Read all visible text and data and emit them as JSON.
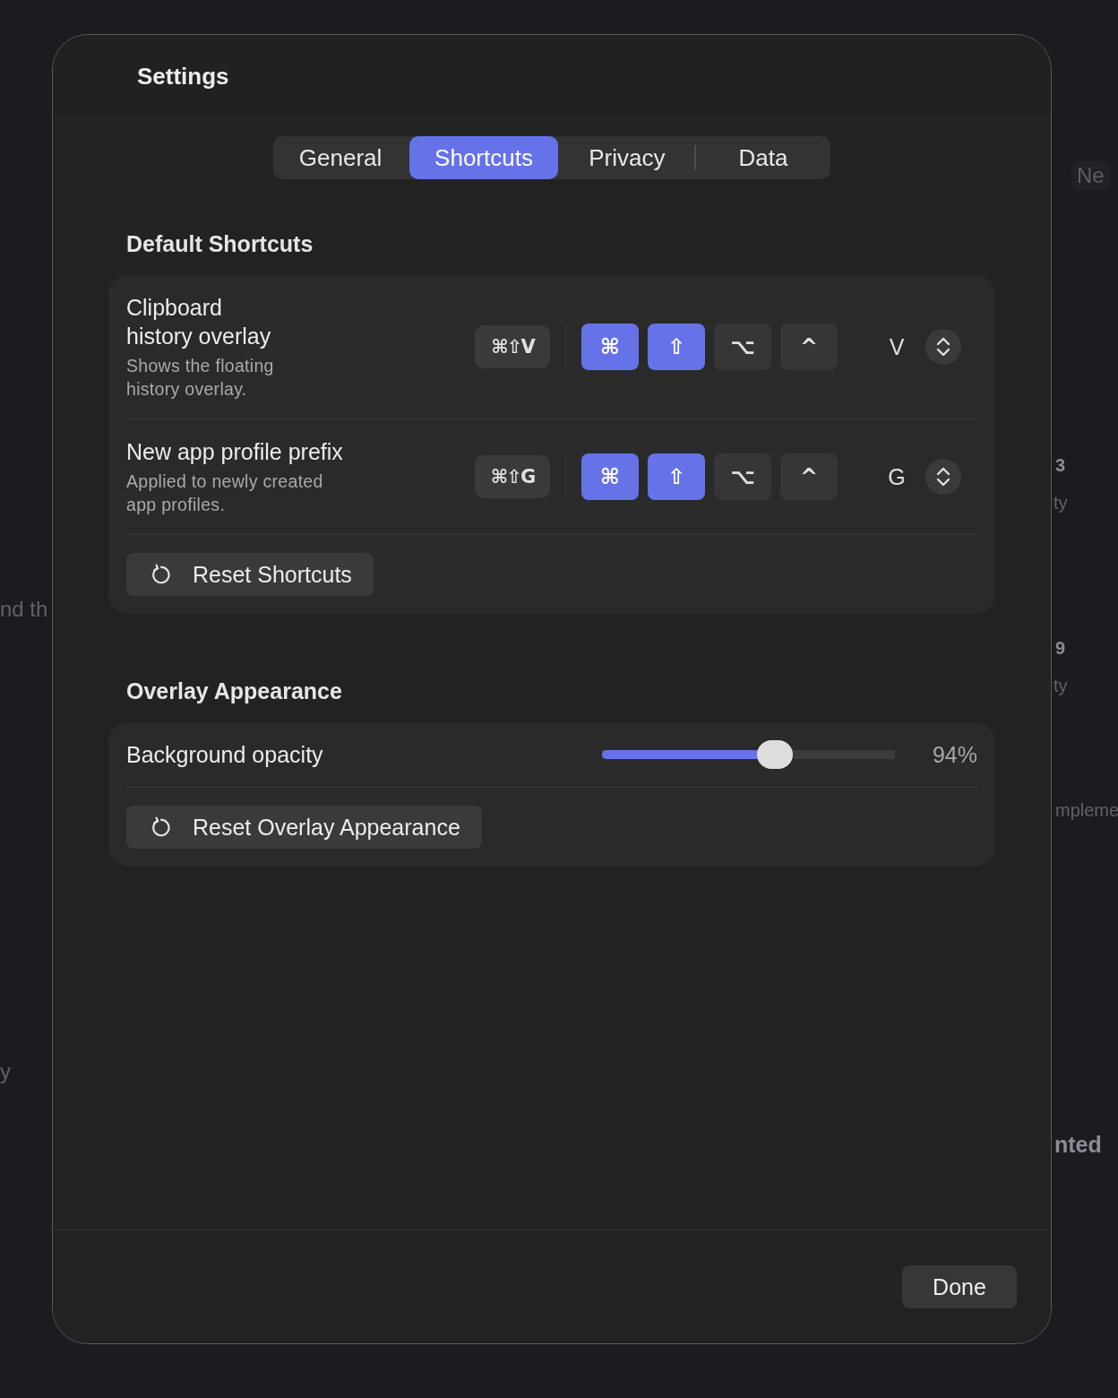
{
  "backdrop": {
    "fragments": [
      {
        "text": "Ne",
        "kind": "button"
      },
      {
        "text": "3",
        "kind": "strong"
      },
      {
        "text": "ty",
        "kind": "muted"
      },
      {
        "text": "9",
        "kind": "strong"
      },
      {
        "text": "ty",
        "kind": "muted"
      },
      {
        "text": "mpleme",
        "kind": "muted"
      },
      {
        "text": "nted",
        "kind": "strong"
      },
      {
        "text": "nd th",
        "kind": "muted"
      },
      {
        "text": "y",
        "kind": "muted"
      }
    ]
  },
  "window": {
    "title": "Settings"
  },
  "tabs": [
    {
      "label": "General",
      "selected": false
    },
    {
      "label": "Shortcuts",
      "selected": true
    },
    {
      "label": "Privacy",
      "selected": false
    },
    {
      "label": "Data",
      "selected": false
    }
  ],
  "sections": [
    {
      "title": "Default Shortcuts",
      "rows": [
        {
          "kind": "shortcut",
          "title": "Clipboard\nhistory overlay",
          "description": "Shows the floating\nhistory overlay.",
          "summary": "⌘⇧V",
          "modifiers": [
            {
              "symbol": "⌘",
              "on": true
            },
            {
              "symbol": "⇧",
              "on": true
            },
            {
              "symbol": "⌥",
              "on": false
            },
            {
              "symbol": "^",
              "on": false
            }
          ],
          "key": "V"
        },
        {
          "kind": "shortcut",
          "title": "New app profile prefix",
          "description": "Applied to newly created\napp profiles.",
          "summary": "⌘⇧G",
          "modifiers": [
            {
              "symbol": "⌘",
              "on": true
            },
            {
              "symbol": "⇧",
              "on": true
            },
            {
              "symbol": "⌥",
              "on": false
            },
            {
              "symbol": "^",
              "on": false
            }
          ],
          "key": "G"
        }
      ],
      "reset": "Reset Shortcuts"
    },
    {
      "title": "Overlay Appearance",
      "rows": [
        {
          "kind": "slider",
          "title": "Background opacity",
          "level": 0.59,
          "reading": "94%"
        }
      ],
      "reset": "Reset Overlay Appearance"
    }
  ],
  "footer": {
    "button": "Done"
  }
}
